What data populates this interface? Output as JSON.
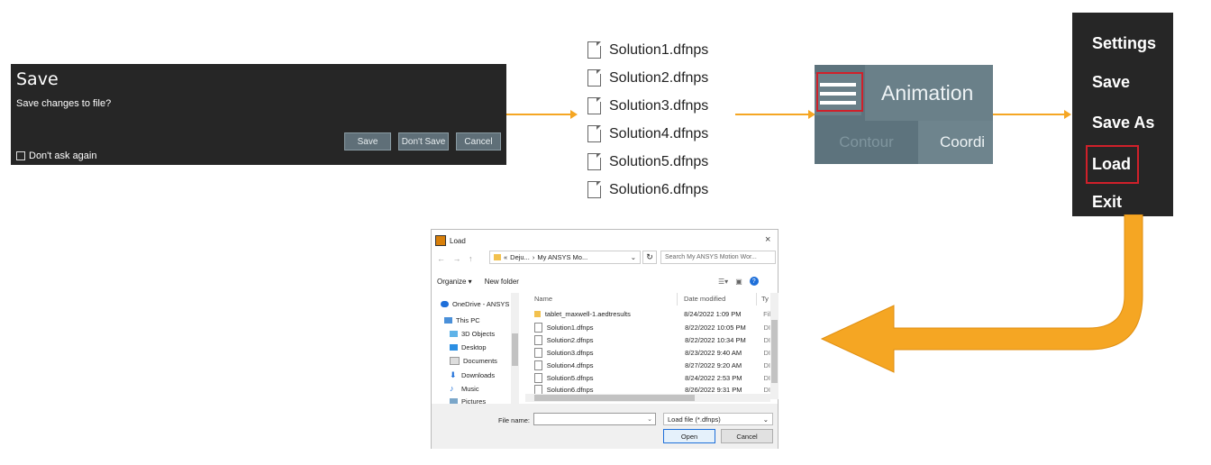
{
  "save_dialog": {
    "title": "Save",
    "message": "Save changes to file?",
    "save_label": "Save",
    "dont_save_label": "Don't Save",
    "cancel_label": "Cancel",
    "dont_ask_label": "Don't ask again"
  },
  "file_list": [
    "Solution1.dfnps",
    "Solution2.dfnps",
    "Solution3.dfnps",
    "Solution4.dfnps",
    "Solution5.dfnps",
    "Solution6.dfnps"
  ],
  "animation_panel": {
    "animation_label": "Animation",
    "contour_label": "Contour",
    "coordinate_label": "Coordi"
  },
  "file_menu": [
    "Settings",
    "Save",
    "Save As",
    "Load",
    "Exit"
  ],
  "load_dialog": {
    "title": "Load",
    "close_glyph": "×",
    "nav_arrows": "← → ↑",
    "address_prefix": "«",
    "address_part1": "Deju...",
    "address_sep": "›",
    "address_part2": "My ANSYS Mo...",
    "search_placeholder": "Search My ANSYS Motion Wor...",
    "organize_label": "Organize ▾",
    "new_folder_label": "New folder",
    "nav_items": [
      "OneDrive - ANSYS",
      "This PC",
      "3D Objects",
      "Desktop",
      "Documents",
      "Downloads",
      "Music",
      "Pictures"
    ],
    "columns": {
      "name": "Name",
      "date": "Date modified",
      "type": "Ty"
    },
    "files": [
      {
        "name": "tablet_maxwell-1.aedtresults",
        "date": "8/24/2022 1:09 PM",
        "type": "Fil",
        "folder": true
      },
      {
        "name": "Solution1.dfnps",
        "date": "8/22/2022 10:05 PM",
        "type": "DI"
      },
      {
        "name": "Solution2.dfnps",
        "date": "8/22/2022 10:34 PM",
        "type": "DI"
      },
      {
        "name": "Solution3.dfnps",
        "date": "8/23/2022 9:40 AM",
        "type": "DI"
      },
      {
        "name": "Solution4.dfnps",
        "date": "8/27/2022 9:20 AM",
        "type": "DI"
      },
      {
        "name": "Solution5.dfnps",
        "date": "8/24/2022 2:53 PM",
        "type": "DI"
      },
      {
        "name": "Solution6.dfnps",
        "date": "8/26/2022 9:31 PM",
        "type": "DI"
      }
    ],
    "file_name_label": "File name:",
    "filter_label": "Load file (*.dfnps)",
    "open_label": "Open",
    "cancel_label": "Cancel"
  },
  "colors": {
    "arrow": "#f5a623",
    "highlight": "#d0202a",
    "dark_bg": "#262626",
    "panel_bg": "#5d737d"
  }
}
